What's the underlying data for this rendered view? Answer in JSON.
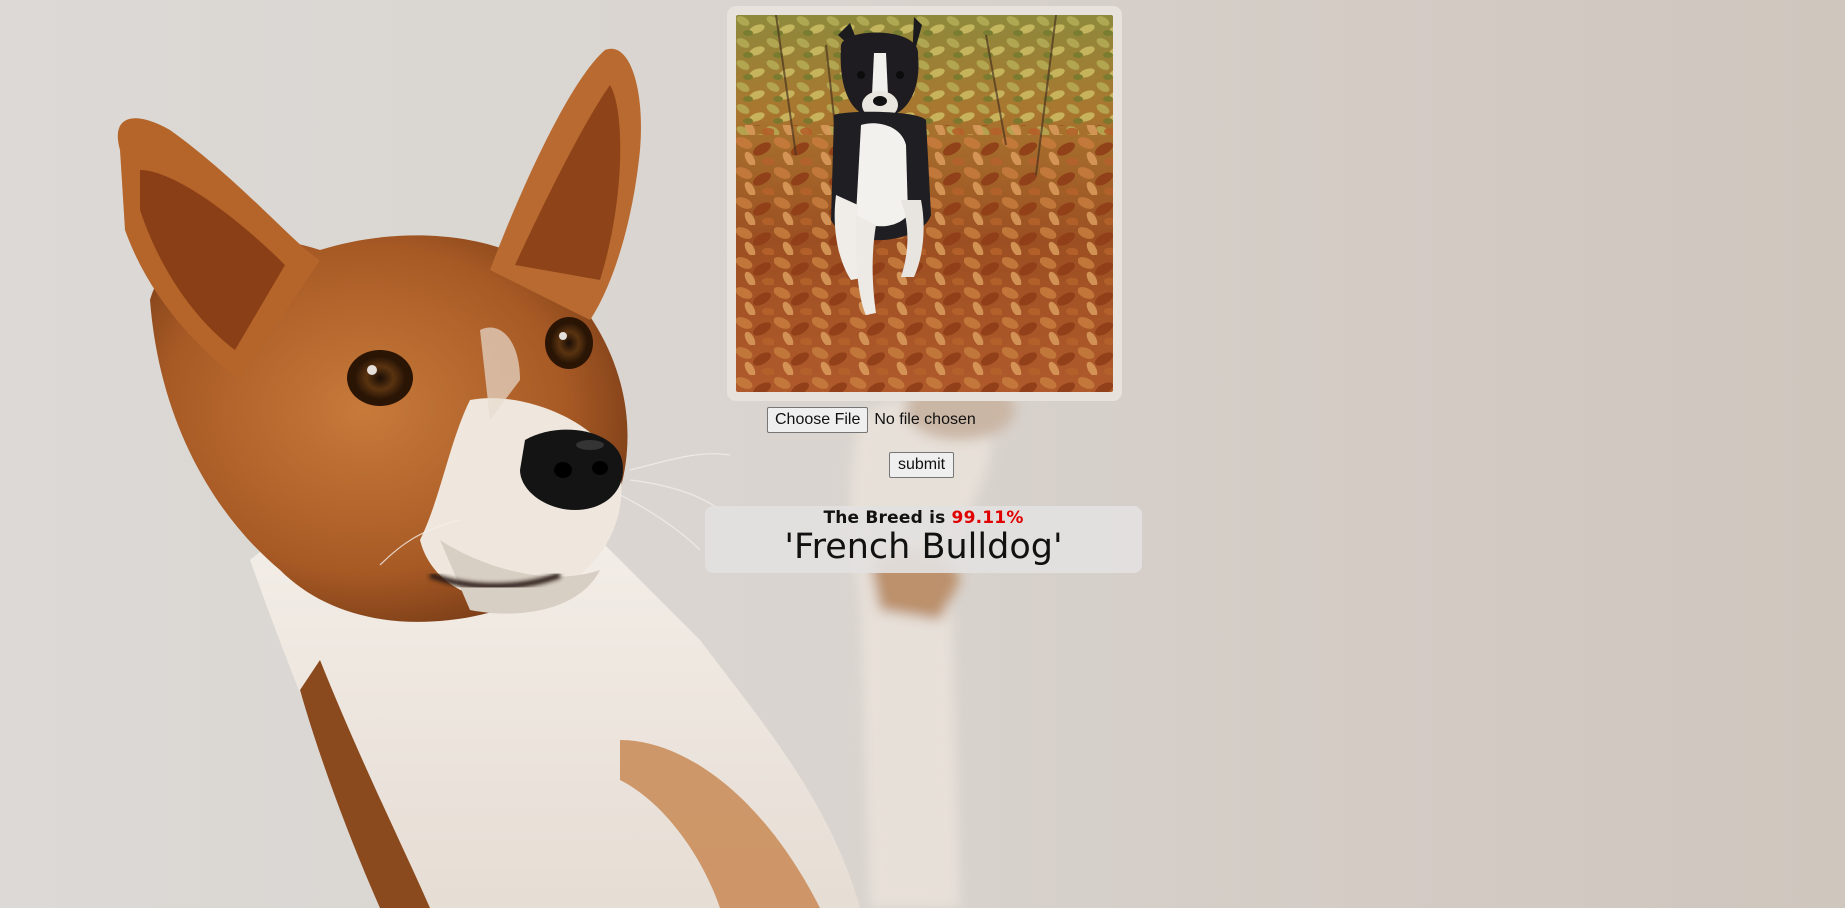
{
  "upload": {
    "choose_label": "Choose File",
    "status": "No file chosen"
  },
  "actions": {
    "submit_label": "submit"
  },
  "result": {
    "prefix": "The Breed is",
    "confidence": "99.11%",
    "breed": "'French Bulldog'"
  },
  "colors": {
    "confidence": "#e00000",
    "background": "#d9d4cf",
    "panel": "#e3e1e0"
  },
  "icons": {
    "background": "basenji-dog-illustration",
    "photo": "boston-terrier-in-autumn-leaves"
  }
}
